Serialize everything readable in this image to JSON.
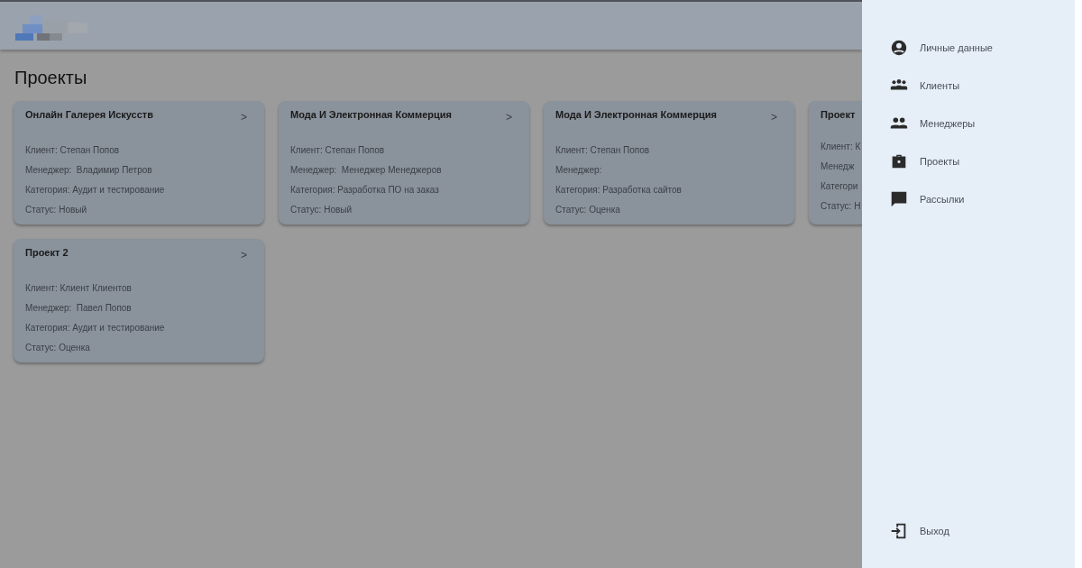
{
  "page_title": "Проекты",
  "projects": [
    {
      "title": "Онлайн Галерея Искусств",
      "lines": [
        "Клиент: Степан Попов",
        "Менеджер:  Владимир Петров",
        "Категория: Аудит и тестирование",
        "Статус: Новый"
      ],
      "arrow": ">"
    },
    {
      "title": "Мода И Электронная Коммерция",
      "lines": [
        "Клиент: Степан Попов",
        "Менеджер:  Менеджер Менеджеров",
        "Категория: Разработка ПО на заказ",
        "Статус: Новый"
      ],
      "arrow": ">"
    },
    {
      "title": "Мода И Электронная Коммерция",
      "lines": [
        "Клиент: Степан Попов",
        "Менеджер:",
        "Категория: Разработка сайтов",
        "Статус: Оценка"
      ],
      "arrow": ">"
    },
    {
      "title": "Проект",
      "lines": [
        "Клиент: К",
        "Менедж",
        "Категори",
        "Статус: Н"
      ]
    },
    {
      "title": "Проект 2",
      "lines": [
        "Клиент: Клиент Клиентов",
        "Менеджер:  Павел Попов",
        "Категория: Аудит и тестирование",
        "Статус: Оценка"
      ],
      "arrow": ">"
    }
  ],
  "drawer": {
    "items": [
      {
        "kind": "account",
        "label": "Личные данные"
      },
      {
        "kind": "clients",
        "label": "Клиенты"
      },
      {
        "kind": "managers",
        "label": "Менеджеры"
      },
      {
        "kind": "projects",
        "label": "Проекты"
      },
      {
        "kind": "mailings",
        "label": "Рассылки"
      }
    ],
    "footer_item": {
      "kind": "logout",
      "label": "Выход"
    }
  }
}
